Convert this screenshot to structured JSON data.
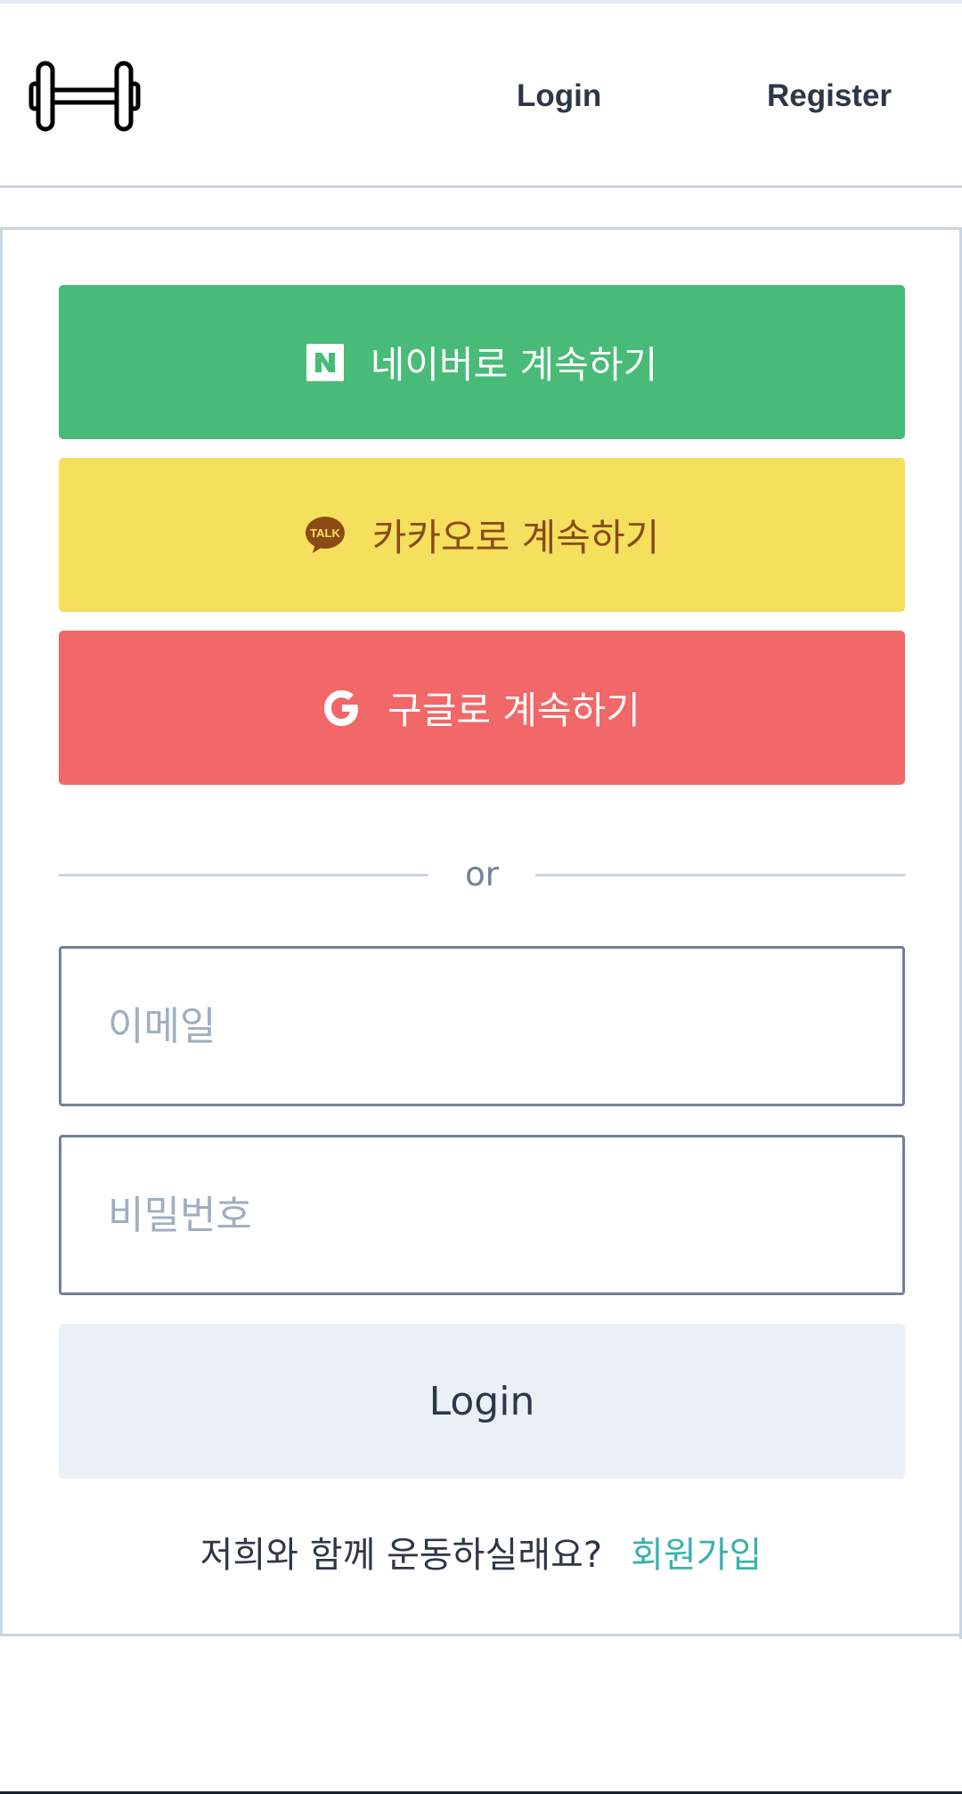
{
  "header": {
    "logo_icon": "dumbbell-icon",
    "nav": {
      "login_label": "Login",
      "register_label": "Register"
    }
  },
  "social": {
    "naver": {
      "label": "네이버로 계속하기",
      "icon": "naver-n-icon",
      "color": "#48bb78"
    },
    "kakao": {
      "label": "카카오로 계속하기",
      "icon": "kakao-talk-icon",
      "icon_text": "TALK",
      "color": "#f5e05e"
    },
    "google": {
      "label": "구글로 계속하기",
      "icon": "google-g-icon",
      "color": "#f26767"
    }
  },
  "divider": {
    "text": "or"
  },
  "form": {
    "email": {
      "placeholder": "이메일",
      "value": ""
    },
    "password": {
      "placeholder": "비밀번호",
      "value": ""
    },
    "submit_label": "Login"
  },
  "signup": {
    "prompt": "저희와 함께 운동하실래요?",
    "link_label": "회원가입",
    "link_color": "#38b2ac"
  }
}
